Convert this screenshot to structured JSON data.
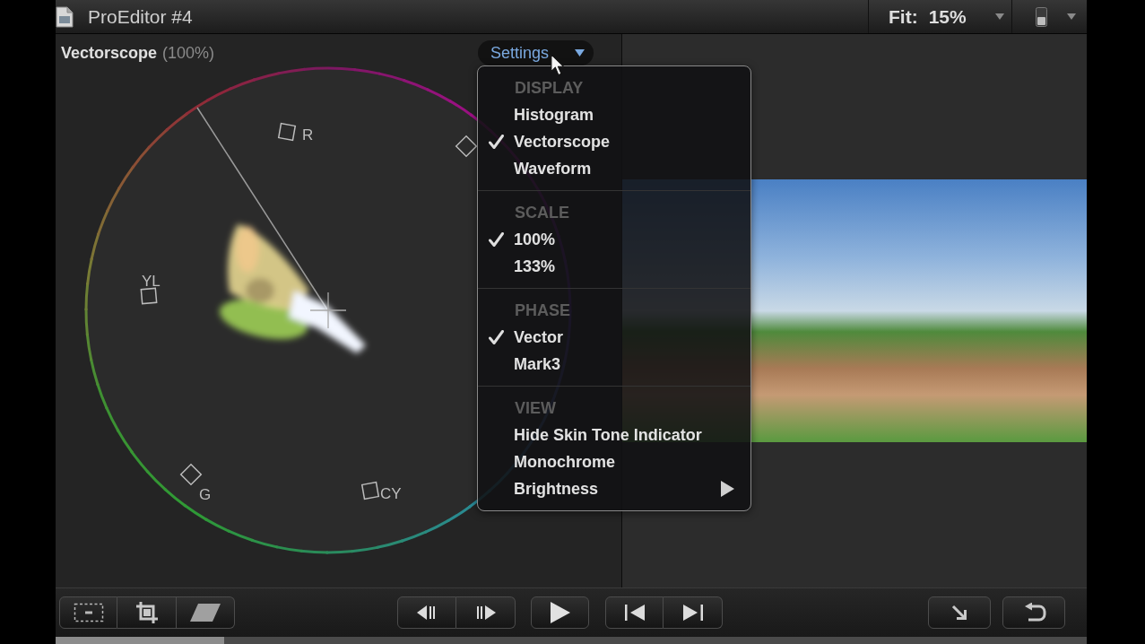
{
  "window": {
    "title": "ProEditor #4"
  },
  "zoom": {
    "label": "Fit:",
    "value": "15%"
  },
  "scope": {
    "title": "Vectorscope",
    "scale": "(100%)",
    "targets": [
      {
        "label": "R"
      },
      {
        "label": "YL"
      },
      {
        "label": "G"
      },
      {
        "label": "CY"
      }
    ]
  },
  "settings": {
    "label": "Settings",
    "expanded": true,
    "sections": [
      {
        "heading": "DISPLAY",
        "items": [
          {
            "label": "Histogram",
            "checked": false,
            "submenu": false
          },
          {
            "label": "Vectorscope",
            "checked": true,
            "submenu": false
          },
          {
            "label": "Waveform",
            "checked": false,
            "submenu": false
          }
        ]
      },
      {
        "heading": "SCALE",
        "items": [
          {
            "label": "100%",
            "checked": true,
            "submenu": false
          },
          {
            "label": "133%",
            "checked": false,
            "submenu": false
          }
        ]
      },
      {
        "heading": "PHASE",
        "items": [
          {
            "label": "Vector",
            "checked": true,
            "submenu": false
          },
          {
            "label": "Mark3",
            "checked": false,
            "submenu": false
          }
        ]
      },
      {
        "heading": "VIEW",
        "items": [
          {
            "label": "Hide Skin Tone Indicator",
            "checked": false,
            "submenu": false
          },
          {
            "label": "Monochrome",
            "checked": false,
            "submenu": false
          },
          {
            "label": "Brightness",
            "checked": false,
            "submenu": true
          }
        ]
      }
    ]
  }
}
